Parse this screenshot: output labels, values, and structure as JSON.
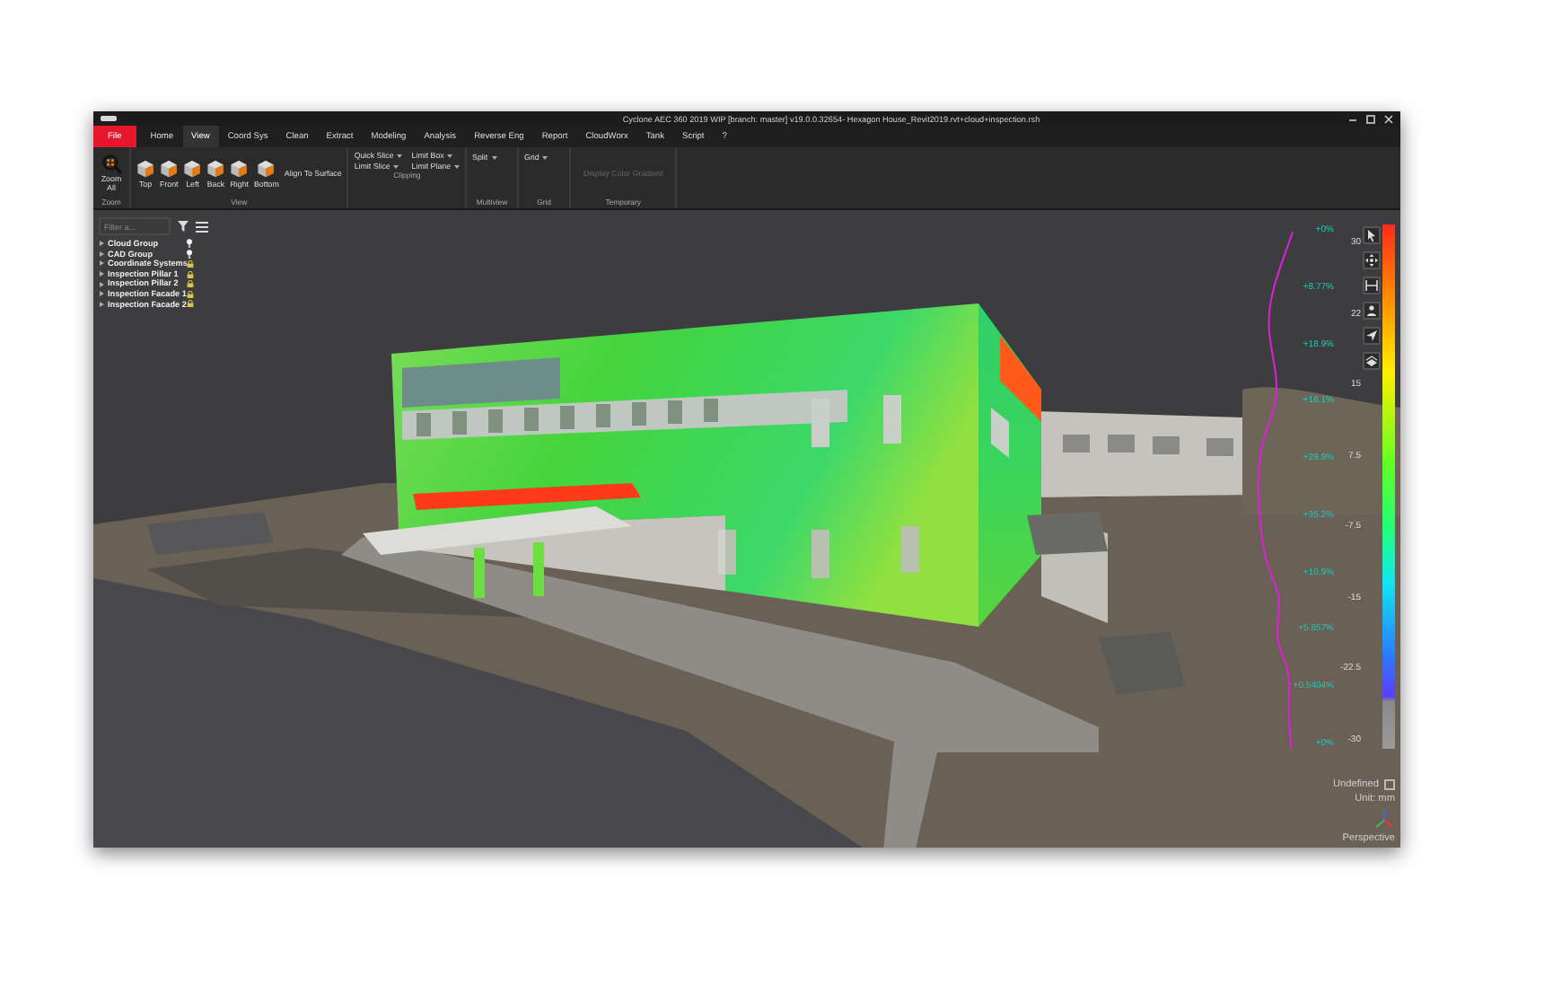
{
  "window": {
    "title": "Cyclone AEC 360 2019 WIP [branch: master] v19.0.0.32654- Hexagon House_Revit2019.rvt+cloud+inspection.rsh"
  },
  "menu": [
    {
      "label": "File",
      "kind": "file",
      "selected": false
    },
    {
      "label": "Home",
      "kind": "tab",
      "selected": false
    },
    {
      "label": "View",
      "kind": "tab",
      "selected": true
    },
    {
      "label": "Coord Sys",
      "kind": "tab",
      "selected": false
    },
    {
      "label": "Clean",
      "kind": "tab",
      "selected": false
    },
    {
      "label": "Extract",
      "kind": "tab",
      "selected": false
    },
    {
      "label": "Modeling",
      "kind": "tab",
      "selected": false
    },
    {
      "label": "Analysis",
      "kind": "tab",
      "selected": false
    },
    {
      "label": "Reverse Eng",
      "kind": "tab",
      "selected": false
    },
    {
      "label": "Report",
      "kind": "tab",
      "selected": false
    },
    {
      "label": "CloudWorx",
      "kind": "tab",
      "selected": false
    },
    {
      "label": "Tank",
      "kind": "tab",
      "selected": false
    },
    {
      "label": "Script",
      "kind": "tab",
      "selected": false
    },
    {
      "label": "?",
      "kind": "tab",
      "selected": false
    }
  ],
  "ribbon": [
    {
      "label": "Zoom",
      "items": [
        {
          "label": "Zoom All",
          "kind": "zoom",
          "disabled": false
        }
      ]
    },
    {
      "label": "View",
      "items": [
        {
          "label": "Top",
          "kind": "cube",
          "disabled": false
        },
        {
          "label": "Front",
          "kind": "cube",
          "disabled": false
        },
        {
          "label": "Left",
          "kind": "cube",
          "disabled": false
        },
        {
          "label": "Back",
          "kind": "cube",
          "disabled": false
        },
        {
          "label": "Right",
          "kind": "cube",
          "disabled": false
        },
        {
          "label": "Bottom",
          "kind": "cube",
          "disabled": false
        },
        {
          "label": "Align To Surface",
          "kind": "text",
          "disabled": false
        }
      ]
    },
    {
      "label": "Clipping",
      "items": [
        {
          "label": "Quick Slice",
          "kind": "dropdown",
          "disabled": false
        },
        {
          "label": "Limit Box",
          "kind": "dropdown",
          "disabled": false
        },
        {
          "label": "Limit Slice",
          "kind": "dropdown",
          "disabled": false
        },
        {
          "label": "Limit Plane",
          "kind": "dropdown",
          "disabled": false
        }
      ]
    },
    {
      "label": "Multiview",
      "items": [
        {
          "label": "Split",
          "kind": "dropdown",
          "disabled": false
        }
      ]
    },
    {
      "label": "Grid",
      "items": [
        {
          "label": "Grid",
          "kind": "dropdown",
          "disabled": false
        }
      ]
    },
    {
      "label": "Temporary",
      "items": [
        {
          "label": "Display Color Gradient",
          "kind": "text",
          "disabled": true
        }
      ]
    }
  ],
  "tree": {
    "filter": {
      "placeholder": "Filter a..."
    },
    "items": [
      {
        "label": "Cloud Group",
        "kind": "bulb",
        "expanded": false
      },
      {
        "label": "CAD Group",
        "kind": "bulb",
        "expanded": false
      },
      {
        "label": "Coordinate Systems",
        "kind": "lock",
        "expanded": false
      },
      {
        "label": "Inspection Pillar 1",
        "kind": "lock",
        "expanded": false
      },
      {
        "label": "Inspection Pillar 2",
        "kind": "lock",
        "expanded": false
      },
      {
        "label": "Inspection Facade 1",
        "kind": "lock",
        "expanded": false
      },
      {
        "label": "Inspection Facade 2",
        "kind": "lock",
        "expanded": false
      }
    ]
  },
  "scale": {
    "percentages": [
      "+0%",
      "+8.77%",
      "+18.9%",
      "+16.1%",
      "+29.9%",
      "+35.2%",
      "+10.9%",
      "+5.857%",
      "+0.5404%",
      "+0%"
    ],
    "values": [
      "30",
      "22",
      "15",
      "7.5",
      "-7.5",
      "-15",
      "-22.5",
      "-30"
    ],
    "undefined": {
      "label": "Undefined",
      "checked": false
    },
    "unit": "Unit: mm",
    "projection": "Perspective"
  }
}
